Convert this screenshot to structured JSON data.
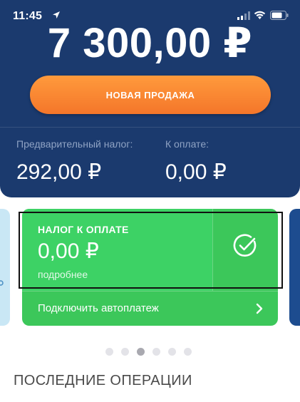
{
  "status_bar": {
    "time": "11:45"
  },
  "header": {
    "balance": "7 300,00 ₽",
    "sale_button_label": "НОВАЯ ПРОДАЖА",
    "prepaid_tax_label": "Предварительный налог:",
    "prepaid_tax_value": "292,00 ₽",
    "to_pay_label": "К оплате:",
    "to_pay_value": "0,00 ₽"
  },
  "tax_card": {
    "title": "НАЛОГ К ОПЛАТЕ",
    "amount": "0,00 ₽",
    "details_link": "подробнее",
    "autopay_label": "Подключить автоплатеж"
  },
  "carousel": {
    "page_count": 6,
    "active_index": 2
  },
  "recent": {
    "title": "ПОСЛЕДНИЕ ОПЕРАЦИИ"
  },
  "colors": {
    "header_bg": "#1b3a6e",
    "accent_orange": "#f4762a",
    "card_green": "#3cc75a"
  }
}
